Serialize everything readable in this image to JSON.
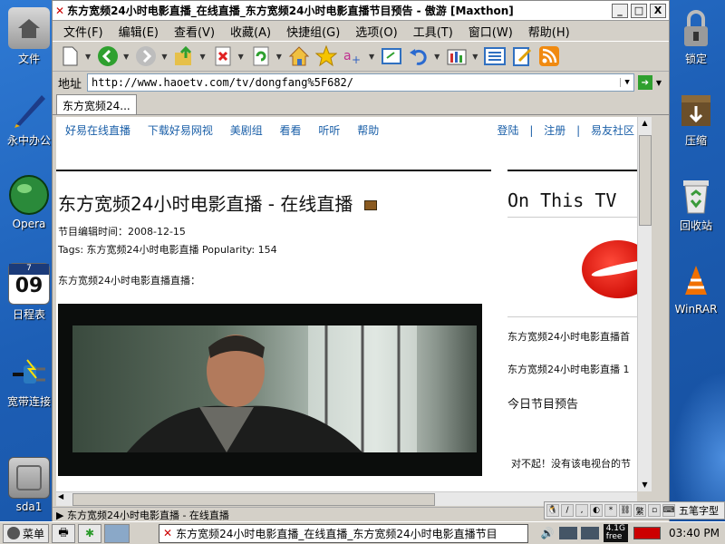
{
  "window": {
    "title": "东方宽频24小时电影直播_在线直播_东方宽频24小时电影直播节目预告 - 傲游 [Maxthon]",
    "minimize": "_",
    "maximize": "□",
    "close": "X"
  },
  "menu": [
    "文件(F)",
    "编辑(E)",
    "查看(V)",
    "收藏(A)",
    "快捷组(G)",
    "选项(O)",
    "工具(T)",
    "窗口(W)",
    "帮助(H)"
  ],
  "address": {
    "label": "地址",
    "url": "http://www.haoetv.com/tv/dongfang%5F682/"
  },
  "tab": {
    "label": "东方宽频24..."
  },
  "page": {
    "nav_left": [
      "好易在线直播",
      "下载好易网视",
      "美剧组",
      "看看",
      "听听",
      "帮助"
    ],
    "nav_right": [
      "登陆",
      "|",
      "注册",
      "|",
      "易友社区"
    ],
    "heading": "东方宽频24小时电影直播 - 在线直播",
    "edit_time": "节目编辑时间：2008-12-15",
    "tags": "Tags: 东方宽频24小时电影直播 Popularity: 154",
    "subheading": "东方宽频24小时电影直播直播：",
    "side_title": "On This TV",
    "side_item1": "东方宽频24小时电影直播首",
    "side_item2": "东方宽频24小时电影直播 1",
    "side_schedule": "今日节目预告",
    "side_notice": "对不起！没有该电视台的节"
  },
  "status": {
    "text": "▶ 东方宽频24小时电影直播 - 在线直播"
  },
  "desktop_left": [
    {
      "name": "文件",
      "icon": "home-folder-icon"
    },
    {
      "name": "永中办公",
      "icon": "office-pen-icon"
    },
    {
      "name": "Opera",
      "icon": "opera-globe-icon"
    },
    {
      "name": "日程表",
      "icon": "calendar-icon",
      "day": "09",
      "month": "7"
    },
    {
      "name": "宽带连接",
      "icon": "plug-icon"
    },
    {
      "name": "sda1",
      "icon": "drive-icon"
    }
  ],
  "desktop_right": [
    {
      "name": "锁定",
      "icon": "lock-icon"
    },
    {
      "name": "压缩",
      "icon": "box-icon"
    },
    {
      "name": "回收站",
      "icon": "recycle-icon"
    },
    {
      "name": "WinRAR",
      "icon": "winrar-cone-icon"
    }
  ],
  "taskbar": {
    "start": "菜单",
    "task": "东方宽频24小时电影直播_在线直播_东方宽频24小时电影直播节目",
    "memory": "4.1G",
    "memory_sub": "free",
    "clock": "03:40 PM",
    "ime": "五笔字型"
  }
}
